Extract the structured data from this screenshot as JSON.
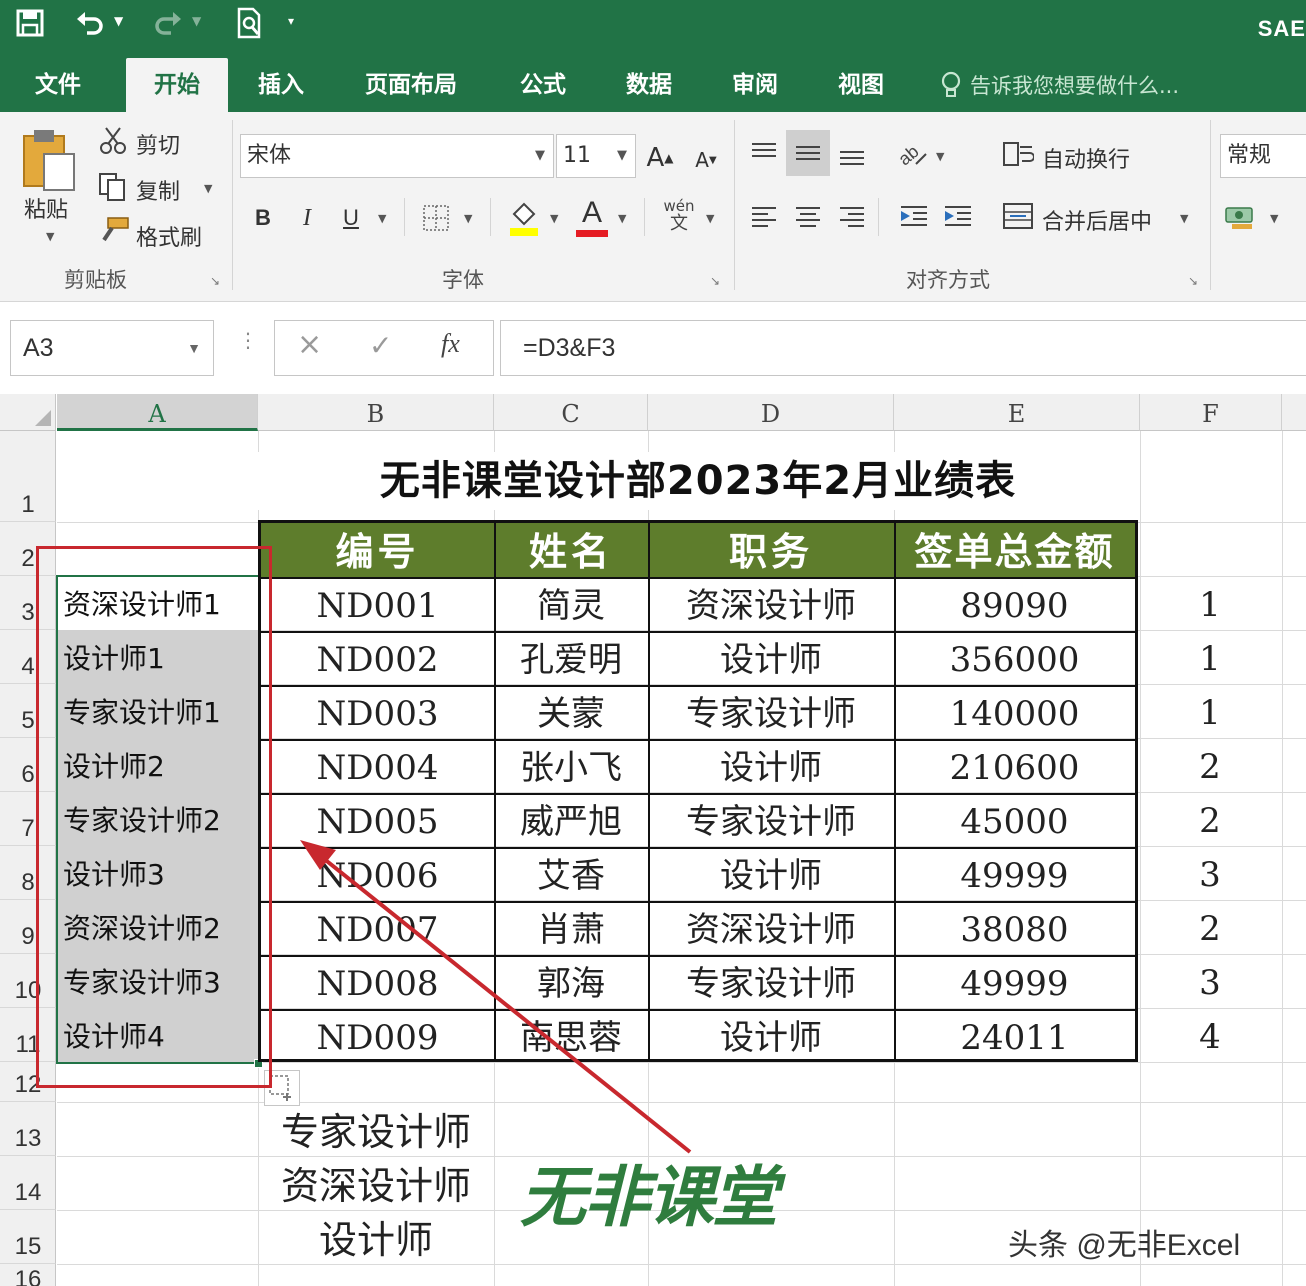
{
  "app": {
    "name_fragment": "SAE"
  },
  "ribbon_tabs": [
    "文件",
    "开始",
    "插入",
    "页面布局",
    "公式",
    "数据",
    "审阅",
    "视图"
  ],
  "active_tab": "开始",
  "tell_me": "告诉我您想要做什么...",
  "clipboard": {
    "paste": "粘贴",
    "cut": "剪切",
    "copy": "复制",
    "format_painter": "格式刷",
    "group_label": "剪贴板"
  },
  "font": {
    "name": "宋体",
    "size": "11",
    "group_label": "字体",
    "bold": "B",
    "italic": "I",
    "underline": "U",
    "grow": "A",
    "shrink": "A",
    "color_glyph": "A",
    "phonetic_top": "wén",
    "phonetic_bottom": "文"
  },
  "alignment": {
    "wrap_text": "自动换行",
    "merge_center": "合并后居中",
    "group_label": "对齐方式"
  },
  "number": {
    "format": "常规"
  },
  "formula_bar": {
    "name_box": "A3",
    "cancel": "×",
    "enter": "✓",
    "fx": "fx",
    "formula": "=D3&F3"
  },
  "columns": [
    "A",
    "B",
    "C",
    "D",
    "E",
    "F"
  ],
  "rows": [
    "1",
    "2",
    "3",
    "4",
    "5",
    "6",
    "7",
    "8",
    "9",
    "10",
    "11",
    "12",
    "13",
    "14",
    "15",
    "16"
  ],
  "sheet": {
    "title": "无非课堂设计部2023年2月业绩表",
    "headers": [
      "编号",
      "姓名",
      "职务",
      "签单总金额"
    ],
    "records": [
      {
        "id": "ND001",
        "name": "简灵",
        "role": "资深设计师",
        "amount": "89090",
        "f": "1",
        "a": "资深设计师1"
      },
      {
        "id": "ND002",
        "name": "孔爱明",
        "role": "设计师",
        "amount": "356000",
        "f": "1",
        "a": "设计师1"
      },
      {
        "id": "ND003",
        "name": "关蒙",
        "role": "专家设计师",
        "amount": "140000",
        "f": "1",
        "a": "专家设计师1"
      },
      {
        "id": "ND004",
        "name": "张小飞",
        "role": "设计师",
        "amount": "210600",
        "f": "2",
        "a": "设计师2"
      },
      {
        "id": "ND005",
        "name": "威严旭",
        "role": "专家设计师",
        "amount": "45000",
        "f": "2",
        "a": "专家设计师2"
      },
      {
        "id": "ND006",
        "name": "艾香",
        "role": "设计师",
        "amount": "49999",
        "f": "3",
        "a": "设计师3"
      },
      {
        "id": "ND007",
        "name": "肖萧",
        "role": "资深设计师",
        "amount": "38080",
        "f": "2",
        "a": "资深设计师2"
      },
      {
        "id": "ND008",
        "name": "郭海",
        "role": "专家设计师",
        "amount": "49999",
        "f": "3",
        "a": "专家设计师3"
      },
      {
        "id": "ND009",
        "name": "南思蓉",
        "role": "设计师",
        "amount": "24011",
        "f": "4",
        "a": "设计师4"
      }
    ],
    "below_table": [
      "专家设计师",
      "资深设计师",
      "设计师"
    ]
  },
  "watermark": "无非课堂",
  "credit": "头条 @无非Excel",
  "colors": {
    "excel_green": "#217346",
    "header_green": "#5e7d2c",
    "annotation_red": "#c8282e"
  }
}
